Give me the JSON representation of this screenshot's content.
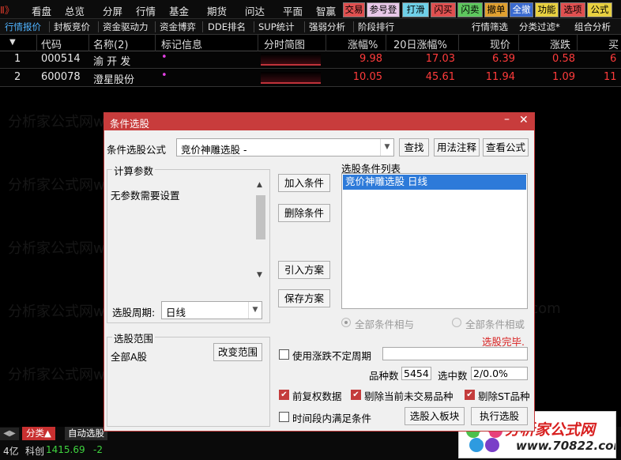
{
  "menubar": {
    "left_glyph": "Ⅱ》",
    "items": [
      "看盘",
      "总览",
      "分屏",
      "行情",
      "基金",
      "期货",
      "问达",
      "平面",
      "智赢"
    ],
    "tool_buttons": [
      {
        "label": "交易",
        "color": "#e05050"
      },
      {
        "label": "参号登",
        "color": "#e8c8e8"
      },
      {
        "label": "打滑",
        "color": "#6fd0e8"
      },
      {
        "label": "闪买",
        "color": "#e05050"
      },
      {
        "label": "闪卖",
        "color": "#5ec85e"
      },
      {
        "label": "撤单",
        "color": "#e0a030"
      },
      {
        "label": "全撤",
        "color": "#3a6ad0"
      },
      {
        "label": "功能",
        "color": "#e8d040"
      },
      {
        "label": "选项",
        "color": "#e05050"
      },
      {
        "label": "公式",
        "color": "#e8d040"
      }
    ]
  },
  "tabs": {
    "items": [
      "行情报价",
      "封板竞价",
      "资金驱动力",
      "资金博弈",
      "DDE排名",
      "SUP统计",
      "强弱分析",
      "阶段排行"
    ],
    "right_items": [
      "行情筛选",
      "分类过滤*",
      "组合分析"
    ]
  },
  "table": {
    "headers": [
      "代码",
      "名称(2)",
      "标记信息",
      "分时简图",
      "涨幅%",
      "20日涨幅%",
      "现价",
      "涨跌",
      "买"
    ],
    "rows": [
      {
        "idx": "1",
        "code": "000514",
        "name": "渝 开 发",
        "mark": "•",
        "chg": "9.98",
        "chg20": "17.03",
        "price": "6.39",
        "diff": "0.58",
        "buy": "6"
      },
      {
        "idx": "2",
        "code": "600078",
        "name": "澄星股份",
        "mark": "•",
        "chg": "10.05",
        "chg20": "45.61",
        "price": "11.94",
        "diff": "1.09",
        "buy": "11"
      }
    ]
  },
  "dialog": {
    "title": "条件选股",
    "formula_label": "条件选股公式",
    "formula_value": "竞价神雕选股  -",
    "find_button": "查找",
    "usage_button": "用法注释",
    "view_formula_button": "查看公式",
    "params_group": "计算参数",
    "params_text": "无参数需要设置",
    "period_label": "选股周期:",
    "period_value": "日线",
    "add_button": "加入条件",
    "delete_button": "删除条件",
    "import_button": "引入方案",
    "save_button": "保存方案",
    "list_group": "选股条件列表",
    "list_items": [
      "竞价神雕选股  日线"
    ],
    "radio_and": "全部条件相与",
    "radio_or": "全部条件相或",
    "status": "选股完毕.",
    "range_group": "选股范围",
    "range_value": "全部A股",
    "change_range_button": "改变范围",
    "use_period_label": "使用涨跌不定周期",
    "count_label": "品种数",
    "count_value": "5454",
    "selected_label": "选中数",
    "selected_value": "2/0.0%",
    "cb_restore": "前复权数据",
    "cb_exclude_untraded": "剔除当前未交易品种",
    "cb_exclude_st": "剔除ST品种",
    "cb_time_range": "时间段内满足条件",
    "to_block_button": "选股入板块",
    "run_button": "执行选股"
  },
  "statusbar": {
    "tab_category": "分类▲",
    "tab_auto": "自动选股",
    "left_value": "4亿",
    "index_name": "科创",
    "index_value": "1415.69",
    "index_change": "-2"
  },
  "watermark": {
    "texts": [
      "分析家公式网www.70822.com",
      "www.70822.com"
    ]
  },
  "logo": {
    "title": "分析家公式网",
    "url": "www.70822.com"
  },
  "colors": {
    "dialog_title_bg": "#c83c3c",
    "up_red": "#ff3b3b",
    "tab_active": "#4fb3ff",
    "list_selected": "#2d7ad9"
  }
}
